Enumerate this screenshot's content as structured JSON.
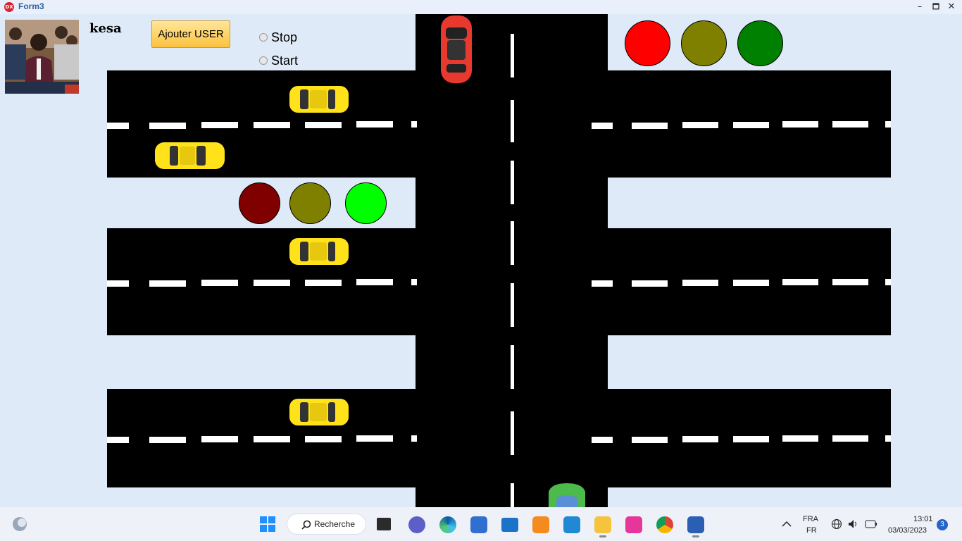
{
  "window": {
    "app_icon": "DX",
    "title": "Form3",
    "minimize": "–",
    "maximize": "🗖",
    "close": "✕"
  },
  "header": {
    "username": "kesa",
    "add_user_label": "Ajouter USER"
  },
  "controls": {
    "stop_label": "Stop",
    "start_label": "Start"
  },
  "traffic_lights": {
    "top": [
      "#ff0000",
      "#808000",
      "#008000"
    ],
    "middle": [
      "#800000",
      "#808000",
      "#00ff00"
    ]
  },
  "cars": {
    "taxi_color": "#ffe21a",
    "red_car_color": "#e8392f",
    "green_car_color": "#4cbb4c"
  },
  "taskbar": {
    "search_label": "Recherche",
    "language_top": "FRA",
    "language_bottom": "FR",
    "time": "13:01",
    "date": "03/03/2023",
    "notification_count": "3"
  }
}
